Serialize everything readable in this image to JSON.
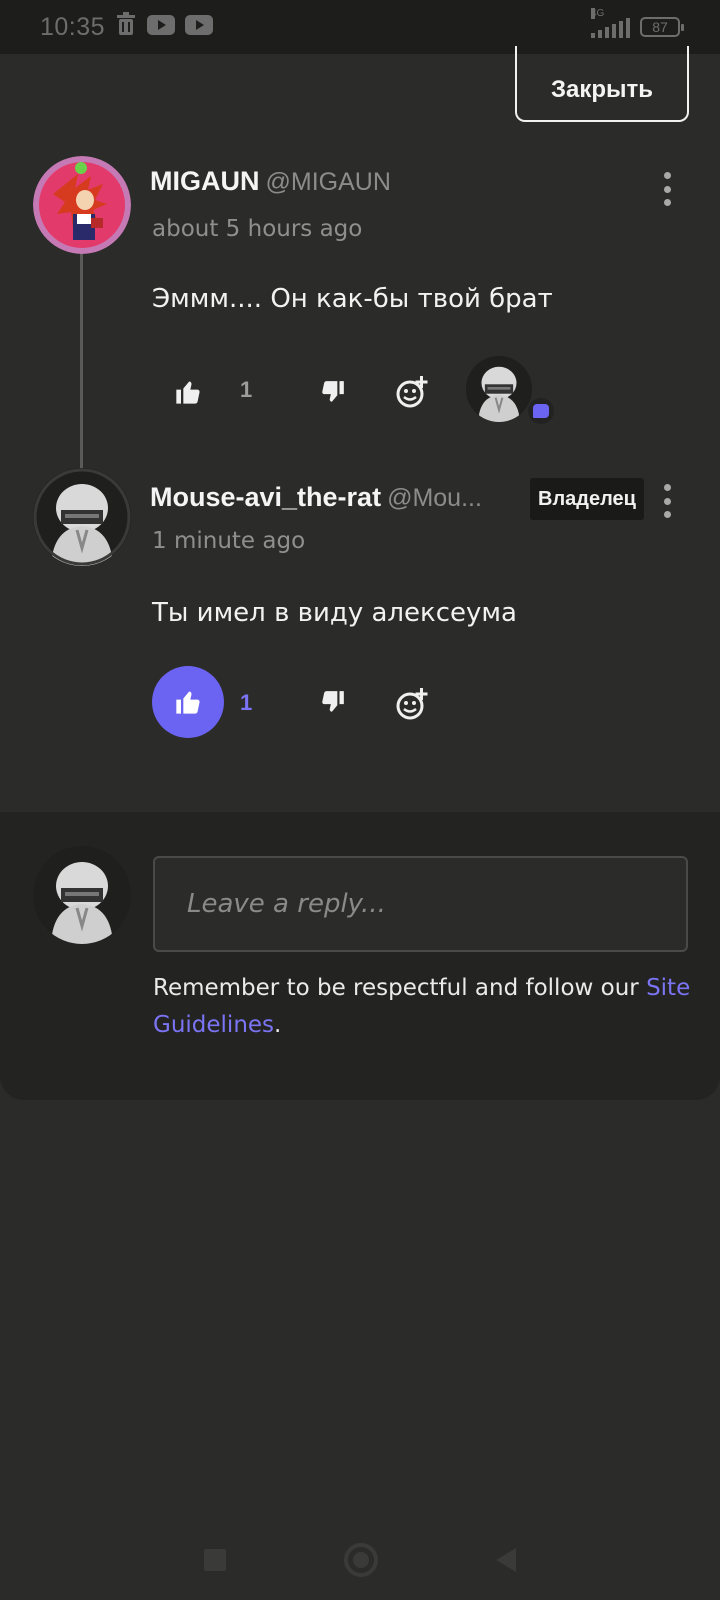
{
  "status_bar": {
    "time": "10:35",
    "network": "4G",
    "battery": "87"
  },
  "header": {
    "close_label": "Закрыть"
  },
  "comments": [
    {
      "author": "MIGAUN",
      "handle": "@MIGAUN",
      "time": "about 5 hours ago",
      "text": "Эммм.... Он как-бы твой брат",
      "likes": "1",
      "liked": false
    },
    {
      "author": "Mouse-avi_the-rat",
      "handle": "@Mou...",
      "badge": "Владелец",
      "time": "1 minute ago",
      "text": "Ты имел в виду алексеума",
      "likes": "1",
      "liked": true
    }
  ],
  "reply": {
    "placeholder": "Leave a reply...",
    "guidelines_text": "Remember to be respectful and follow our ",
    "guidelines_link": "Site Guidelines",
    "guidelines_end": "."
  },
  "colors": {
    "accent": "#6b63f1",
    "background": "#2b2b29",
    "panel": "#232321"
  },
  "icons": [
    "trash-icon",
    "youtube-icon",
    "thumbs-up-icon",
    "thumbs-down-icon",
    "add-reaction-icon",
    "more-vertical-icon"
  ]
}
